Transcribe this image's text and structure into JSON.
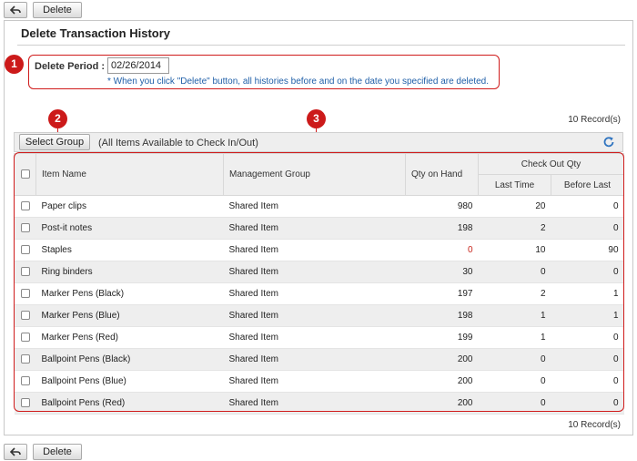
{
  "top_bar": {
    "back_label": "",
    "delete_label": "Delete"
  },
  "bottom_bar": {
    "back_label": "",
    "delete_label": "Delete"
  },
  "page_title": "Delete Transaction History",
  "callouts": [
    "1",
    "2",
    "3"
  ],
  "delete_period": {
    "label": "Delete Period :",
    "value": "02/26/2014",
    "note": "* When you click \"Delete\" button, all histories before and on the date you specified are deleted."
  },
  "records_top": "10 Record(s)",
  "records_bottom": "10 Record(s)",
  "toolbar": {
    "select_group_label": "Select Group",
    "available_text": "(All Items Available to Check In/Out)"
  },
  "table": {
    "headers": {
      "item_name": "Item Name",
      "management_group": "Management Group",
      "qty_on_hand": "Qty on Hand",
      "check_out_qty": "Check Out Qty",
      "last_time": "Last Time",
      "before_last": "Before Last"
    },
    "rows": [
      {
        "name": "Paper clips",
        "group": "Shared Item",
        "qty": "980",
        "last": "20",
        "before": "0"
      },
      {
        "name": "Post-it notes",
        "group": "Shared Item",
        "qty": "198",
        "last": "2",
        "before": "0"
      },
      {
        "name": "Staples",
        "group": "Shared Item",
        "qty": "0",
        "last": "10",
        "before": "90"
      },
      {
        "name": "Ring binders",
        "group": "Shared Item",
        "qty": "30",
        "last": "0",
        "before": "0"
      },
      {
        "name": "Marker Pens (Black)",
        "group": "Shared Item",
        "qty": "197",
        "last": "2",
        "before": "1"
      },
      {
        "name": "Marker Pens (Blue)",
        "group": "Shared Item",
        "qty": "198",
        "last": "1",
        "before": "1"
      },
      {
        "name": "Marker Pens (Red)",
        "group": "Shared Item",
        "qty": "199",
        "last": "1",
        "before": "0"
      },
      {
        "name": "Ballpoint Pens (Black)",
        "group": "Shared Item",
        "qty": "200",
        "last": "0",
        "before": "0"
      },
      {
        "name": "Ballpoint Pens (Blue)",
        "group": "Shared Item",
        "qty": "200",
        "last": "0",
        "before": "0"
      },
      {
        "name": "Ballpoint Pens (Red)",
        "group": "Shared Item",
        "qty": "200",
        "last": "0",
        "before": "0"
      }
    ]
  },
  "colors": {
    "callout": "#cc1a1a",
    "note": "#1f5fa8",
    "zero_stock": "#c8261c",
    "refresh": "#2f74c0"
  }
}
